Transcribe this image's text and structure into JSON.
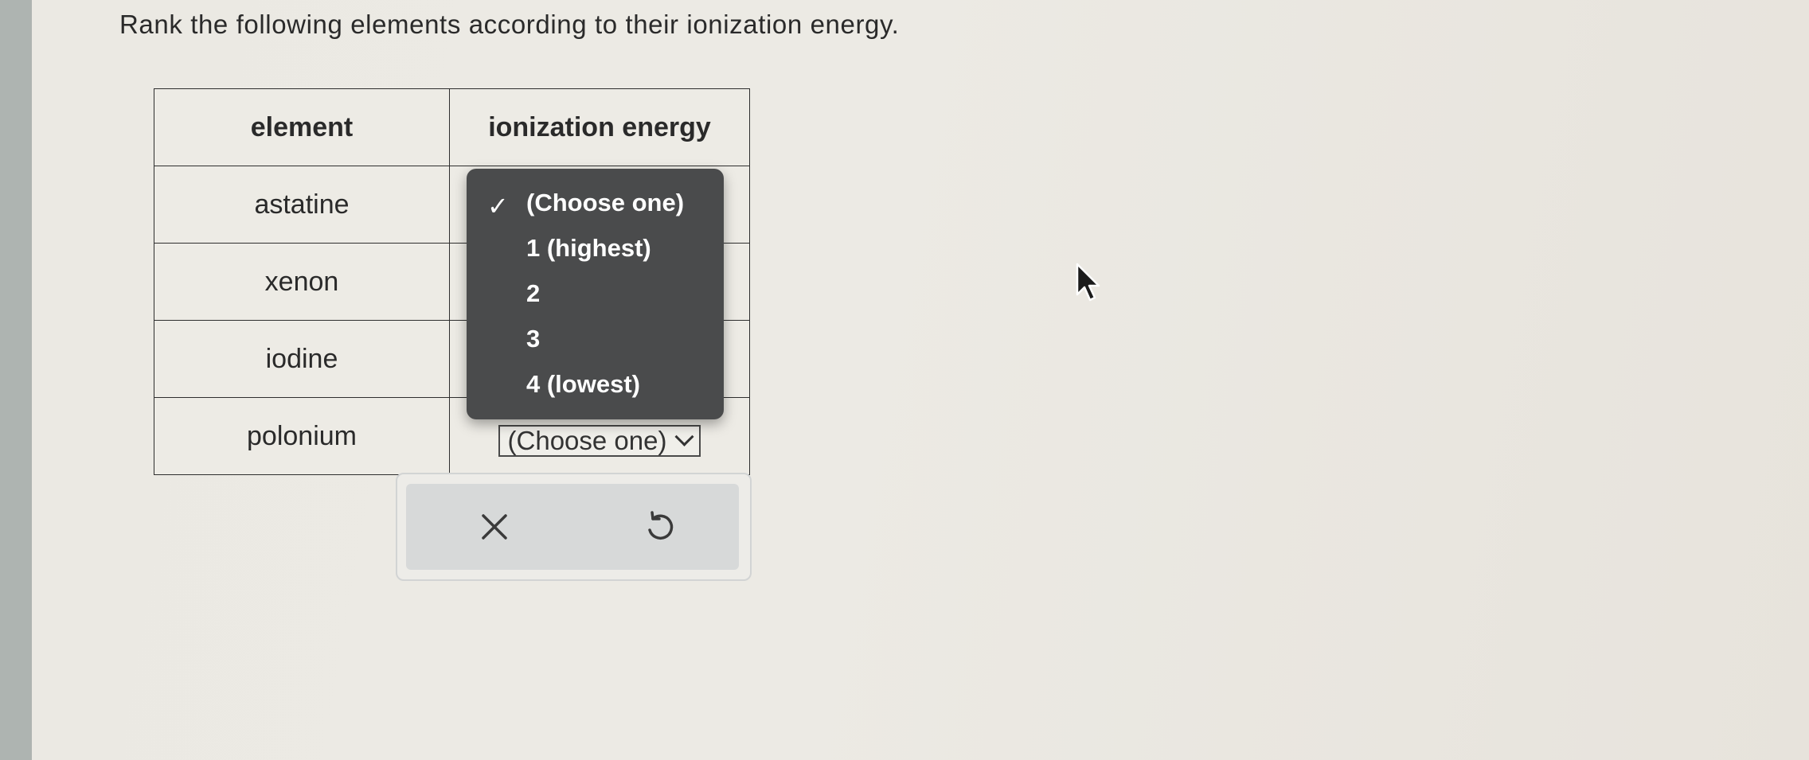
{
  "question": {
    "text": "Rank the following elements according to their ionization energy."
  },
  "table": {
    "headers": [
      "element",
      "ionization energy"
    ],
    "rows": [
      {
        "element": "astatine"
      },
      {
        "element": "xenon"
      },
      {
        "element": "iodine"
      },
      {
        "element": "polonium",
        "selected_value": "(Choose one)"
      }
    ]
  },
  "dropdown": {
    "options": [
      "(Choose one)",
      "1 (highest)",
      "2",
      "3",
      "4 (lowest)"
    ],
    "selected": "(Choose one)",
    "check_glyph": "✓"
  },
  "actions": {
    "clear_icon": "x-icon",
    "undo_icon": "undo-icon"
  },
  "colors": {
    "dropdown_bg": "#4a4b4c",
    "page_bg": "#ebe8e1",
    "action_bar": "#d7d9d9"
  }
}
